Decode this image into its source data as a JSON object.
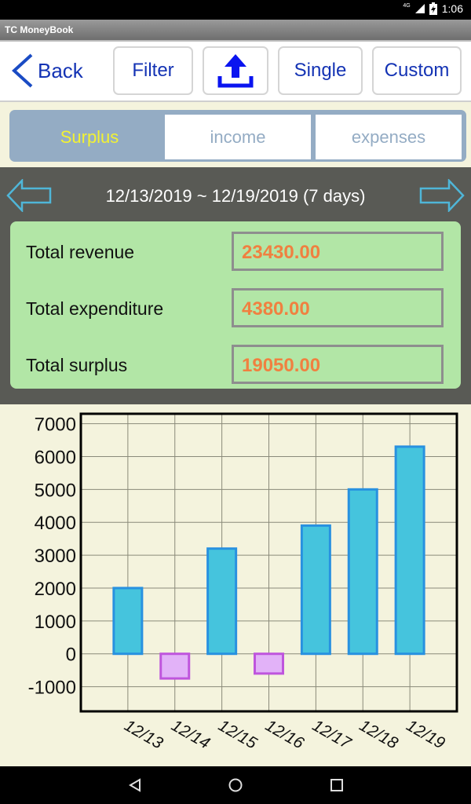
{
  "status_bar": {
    "network": "4G",
    "time": "1:06"
  },
  "app": {
    "title": "TC MoneyBook"
  },
  "toolbar": {
    "back_label": "Back",
    "filter_label": "Filter",
    "export_icon": "upload-icon",
    "single_label": "Single",
    "custom_label": "Custom"
  },
  "tabs": [
    {
      "label": "Surplus",
      "active": true
    },
    {
      "label": "income",
      "active": false
    },
    {
      "label": "expenses",
      "active": false
    }
  ],
  "period": {
    "range": "12/13/2019 ~ 12/19/2019  (7 days)",
    "prev_icon": "arrow-left-icon",
    "next_icon": "arrow-right-icon"
  },
  "summary": {
    "rows": [
      {
        "label": "Total revenue",
        "value": "23430.00"
      },
      {
        "label": "Total expenditure",
        "value": "4380.00"
      },
      {
        "label": "Total surplus",
        "value": "19050.00"
      }
    ]
  },
  "colors": {
    "accent_blue": "#1433b4",
    "positive_fill": "#45c4dd",
    "positive_border": "#2891e0",
    "negative_fill": "#e2b2f8",
    "negative_border": "#bf55dd",
    "value_orange": "#f08040",
    "summary_bg": "#b2e6a6",
    "tab_active_text": "#f2f233"
  },
  "chart_data": {
    "type": "bar",
    "title": "",
    "xlabel": "",
    "ylabel": "",
    "categories": [
      "12/13",
      "12/14",
      "12/15",
      "12/16",
      "12/17",
      "12/18",
      "12/19"
    ],
    "values": [
      2000,
      -750,
      3200,
      -600,
      3900,
      5000,
      6300
    ],
    "ylim": [
      -1750,
      7300
    ],
    "yticks": [
      7000,
      6000,
      5000,
      4000,
      3000,
      2000,
      1000,
      0,
      -1000
    ],
    "ytick_labels": [
      "7000",
      "6000",
      "5000",
      "4000",
      "3000",
      "2000",
      "1000",
      "0",
      "-1000"
    ],
    "grid": true,
    "legend": "none"
  },
  "nav_bar": {
    "back_icon": "nav-back-icon",
    "home_icon": "nav-home-icon",
    "recents_icon": "nav-recents-icon"
  }
}
